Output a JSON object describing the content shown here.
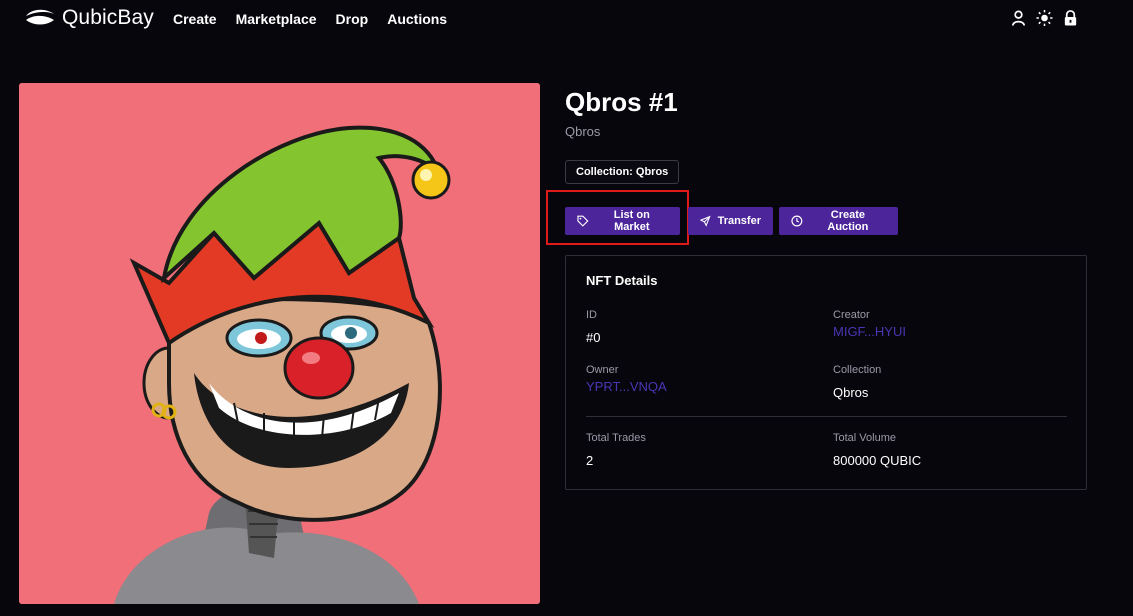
{
  "brand": {
    "name": "QubicBay",
    "accent": "#4c259a",
    "link_color": "#4c35b3"
  },
  "nav": {
    "links": [
      "Create",
      "Marketplace",
      "Drop",
      "Auctions"
    ],
    "icons": [
      "user-icon",
      "sun-icon",
      "lock-icon"
    ]
  },
  "nft": {
    "title": "Qbros #1",
    "subtitle": "Qbros",
    "collection_label": "Collection: Qbros",
    "image_alt": "elf-clown-nft-image"
  },
  "actions": {
    "list_label": "List on Market",
    "transfer_label": "Transfer",
    "auction_label": "Create Auction"
  },
  "details": {
    "heading": "NFT Details",
    "id_label": "ID",
    "id_value": "#0",
    "creator_label": "Creator",
    "creator_value": "MIGF...HYUI",
    "owner_label": "Owner",
    "owner_value": "YPRT...VNQA",
    "collection_label": "Collection",
    "collection_value": "Qbros",
    "trades_label": "Total Trades",
    "trades_value": "2",
    "volume_label": "Total Volume",
    "volume_value": "800000 QUBIC"
  }
}
